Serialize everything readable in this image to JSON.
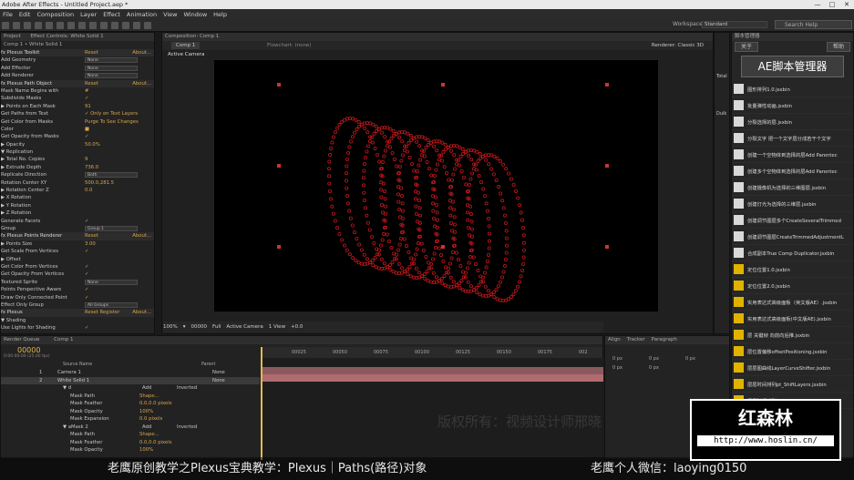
{
  "window": {
    "title": "Adobe After Effects - Untitled Project.aep *",
    "min": "—",
    "max": "□",
    "close": "✕"
  },
  "menu": [
    "File",
    "Edit",
    "Composition",
    "Layer",
    "Effect",
    "Animation",
    "View",
    "Window",
    "Help"
  ],
  "workspace": {
    "label": "Workspace:",
    "value": "Standard",
    "search_placeholder": "Search Help"
  },
  "effect_panel": {
    "tabs": {
      "project": "Project",
      "effect_controls": "Effect Controls: White Solid 1"
    },
    "breadcrumb": "Comp 1 • White Solid 1",
    "rows": [
      {
        "l": "fx  Plexus Toolkit",
        "v": "Reset",
        "x": "About...",
        "h": true
      },
      {
        "l": "    Add Geometry",
        "s": "None"
      },
      {
        "l": "    Add Effector",
        "s": "None"
      },
      {
        "l": "    Add Renderer",
        "s": "None"
      },
      {
        "l": "fx  Plexus Path Object",
        "v": "Reset",
        "x": "About...",
        "h": true
      },
      {
        "l": "    Mask Name Begins with",
        "v": "#"
      },
      {
        "l": "    Subdivide Masks",
        "v": "✓"
      },
      {
        "l": "  ▶ Points on Each Mask",
        "v": "91"
      },
      {
        "l": "    Get Paths from Text",
        "v": "✓ Only on Text Layers"
      },
      {
        "l": "    Get Color from Masks",
        "v": "Purge To See Changes"
      },
      {
        "l": "    Color",
        "v": "■"
      },
      {
        "l": "    Get Opacity from Masks",
        "v": "✓"
      },
      {
        "l": "  ▶ Opacity",
        "v": "50.0%"
      },
      {
        "l": "  ▼ Replication",
        "v": ""
      },
      {
        "l": "    ▶ Total No. Copies",
        "v": "9"
      },
      {
        "l": "    ▶ Extrude Depth",
        "v": "736.0"
      },
      {
        "l": "      Replicate Direction",
        "s": "Both"
      },
      {
        "l": "      Rotation Center XY",
        "v": "500.0,281.5"
      },
      {
        "l": "    ▶ Rotation Center Z",
        "v": "0.0"
      },
      {
        "l": "    ▶ X Rotation",
        "v": ""
      },
      {
        "l": "    ▶ Y Rotation",
        "v": ""
      },
      {
        "l": "    ▶ Z Rotation",
        "v": ""
      },
      {
        "l": "    Generate Facets",
        "v": "✓"
      },
      {
        "l": "    Group",
        "s": "Group 1"
      },
      {
        "l": "fx  Plexus Points Renderer",
        "v": "Reset",
        "x": "About...",
        "h": true
      },
      {
        "l": "  ▶ Points Size",
        "v": "3.00"
      },
      {
        "l": "    Get Scale From Vertices",
        "v": "✓"
      },
      {
        "l": "  ▶ Offset",
        "v": ""
      },
      {
        "l": "    Get Color From Vertices",
        "v": "✓"
      },
      {
        "l": "    Get Opacity From Vertices",
        "v": "✓"
      },
      {
        "l": "    Textured Sprite",
        "s": "None"
      },
      {
        "l": "    Points Perspective Aware",
        "v": "✓"
      },
      {
        "l": "    Draw Only Connected Point",
        "v": "✓"
      },
      {
        "l": "    Effect Only Group",
        "s": "All Groups"
      },
      {
        "l": "fx  Plexus",
        "v": "Reset  Register",
        "x": "About...",
        "h": true
      },
      {
        "l": "  ▼ Shading",
        "v": ""
      },
      {
        "l": "      Use Lights for Shading",
        "v": "✓"
      }
    ]
  },
  "comp_panel": {
    "tab": "Composition: Comp 1",
    "comp_btn": "Comp 1",
    "flowchart": "Flowchart: (none)",
    "renderer": "Renderer:  Classic 3D",
    "active_camera": "Active Camera",
    "viewer_bar": [
      "100%",
      "▾",
      "00000",
      "Full",
      "Active Camera",
      "1 View",
      "+0.0"
    ]
  },
  "right_strip": {
    "labels": [
      "Total",
      "Dulk"
    ]
  },
  "script_panel": {
    "tab": "脚本管理器",
    "close_btn": "关于",
    "help_btn": "帮助",
    "title": "AE脚本管理器",
    "items": [
      "图形排列1.0.jsxbin",
      "批量弹性动画.jsxbin",
      "分裂选择的层.jsxbin",
      "分裂文字 把一个文字层分成若干个文字",
      "创建一个空物体到选择的层Add Parentec",
      "创建多个空物体到选择的层Add Parentec",
      "创建摄像机为选择的三维图层.jsxbin",
      "创建灯光为选择的三维层.jsxbin",
      "创建调节图层多个CreateSeveralTrimmed",
      "创建调节图层CreateTrimmedAdjustmentL",
      "合成副本True Comp Duplicator.jsxbin",
      "定位位置1.0.jsxbin",
      "定位位置2.0.jsxbin",
      "实用表达式高级面板（英文版AE）.jsxbin",
      "实用表达式高级面板(中文版AE).jsxbin",
      "层 关键帧 向前向后推.jsxbin",
      "层位置偏移offsetPositioning.jsxbin",
      "层层图曲线LayerCurveShifter.jsxbin",
      "层层时间排列pt_ShiftLayers.jsxbin",
      "层层时间排列Sequencer.jsxbin"
    ]
  },
  "timeline": {
    "tabs": [
      "Render Queue",
      "Comp 1"
    ],
    "timecode": "00000",
    "fps": "0:00:00:00 (25.00 fps)",
    "col_source": "Source Name",
    "col_parent": "Parent",
    "ruler": [
      "00025",
      "00050",
      "00075",
      "00100",
      "00125",
      "00150",
      "00175",
      "002"
    ],
    "rows": [
      {
        "n": "1",
        "name": "Camera 1",
        "p": "None"
      },
      {
        "n": "2",
        "name": "White Solid 1",
        "p": "None"
      },
      {
        "name": "▼ d",
        "mode": "Add",
        "inv": "Inverted"
      },
      {
        "name": "Mask Path",
        "val": "Shape..."
      },
      {
        "name": "Mask Feather",
        "val": "0.0,0.0 pixels"
      },
      {
        "name": "Mask Opacity",
        "val": "100%"
      },
      {
        "name": "Mask Expansion",
        "val": "0.0 pixels"
      },
      {
        "name": "▼ aMask 2",
        "mode": "Add",
        "inv": "Inverted"
      },
      {
        "name": "Mask Path",
        "val": "Shape..."
      },
      {
        "name": "Mask Feather",
        "val": "0.0,0.0 pixels"
      },
      {
        "name": "Mask Opacity",
        "val": "100%"
      }
    ]
  },
  "para_panel": {
    "tabs": [
      "Align",
      "Tracker",
      "Paragraph"
    ],
    "vals": [
      "0 px",
      "0 px",
      "0 px",
      "0 px",
      "0 px"
    ]
  },
  "overlay": {
    "watermark": "版权所有：视频设计师邢晓",
    "caption_left": "老鹰原创教学之Plexus宝典教学：Plexus｜Paths(路径)对象",
    "caption_right": "老鹰个人微信：laoying0150",
    "logo_cn": "红森林",
    "logo_url": "http://www.hoslin.cn/"
  },
  "colors": {
    "accent": "#d9a54c",
    "ring": "#c0181c",
    "handle": "#c33"
  }
}
